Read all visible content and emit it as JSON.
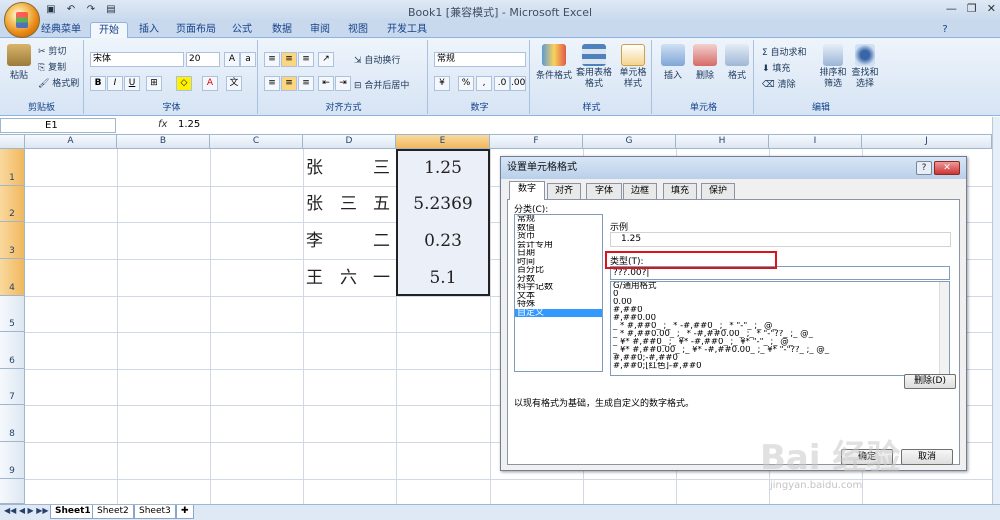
{
  "window": {
    "title": "Book1  [兼容模式] - Microsoft Excel"
  },
  "tabs": [
    "经典菜单",
    "开始",
    "插入",
    "页面布局",
    "公式",
    "数据",
    "审阅",
    "视图",
    "开发工具"
  ],
  "ribbon": {
    "clipboard": {
      "label": "剪贴板",
      "paste": "粘贴",
      "cut": "剪切",
      "copy": "复制",
      "painter": "格式刷"
    },
    "font": {
      "label": "字体",
      "name": "宋体",
      "size": "20"
    },
    "align": {
      "label": "对齐方式",
      "wrap": "自动换行",
      "merge": "合并后居中"
    },
    "number": {
      "label": "数字",
      "format": "常规"
    },
    "styles": {
      "label": "样式",
      "cond": "条件格式",
      "table": "套用表格格式",
      "cell": "单元格样式"
    },
    "cells": {
      "label": "单元格",
      "insert": "插入",
      "delete": "删除",
      "format": "格式"
    },
    "edit": {
      "label": "编辑",
      "autosum": "Σ 自动求和",
      "fill": "填充",
      "clear": "清除",
      "sort": "排序和筛选",
      "find": "查找和选择"
    }
  },
  "formula": {
    "namebox": "E1",
    "fx": "fx",
    "value": "1.25"
  },
  "columns": [
    "A",
    "B",
    "C",
    "D",
    "E",
    "F",
    "G",
    "H",
    "I",
    "J"
  ],
  "rows": [
    "1",
    "2",
    "3",
    "4",
    "5",
    "6",
    "7",
    "8",
    "9"
  ],
  "cells": {
    "names": [
      [
        "张",
        "",
        "三"
      ],
      [
        "张",
        "三",
        "五"
      ],
      [
        "李",
        "",
        "二"
      ],
      [
        "王",
        "六",
        "一"
      ]
    ],
    "values": [
      "1.25",
      "5.2369",
      "0.23",
      "5.1"
    ]
  },
  "sheets": [
    "Sheet1",
    "Sheet2",
    "Sheet3"
  ],
  "dialog": {
    "title": "设置单元格格式",
    "tabs": [
      "数字",
      "对齐",
      "字体",
      "边框",
      "填充",
      "保护"
    ],
    "category_label": "分类(C):",
    "categories": [
      "常规",
      "数值",
      "货币",
      "会计专用",
      "日期",
      "时间",
      "百分比",
      "分数",
      "科学记数",
      "文本",
      "特殊",
      "自定义"
    ],
    "sample_label": "示例",
    "sample_value": "1.25",
    "type_label": "类型(T):",
    "type_value": "???.00?|",
    "formats": [
      "G/通用格式",
      "0",
      "0.00",
      "#,##0",
      "#,##0.00",
      "_ * #,##0_ ;_ * -#,##0_ ;_ * \"-\"_ ;_ @_",
      "_ * #,##0.00_ ;_ * -#,##0.00_ ;_ * \"-\"??_ ;_ @_",
      "_ ¥* #,##0_ ;_ ¥* -#,##0_ ;_ ¥* \"-\"_ ;_ @_",
      "_ ¥* #,##0.00_ ;_ ¥* -#,##0.00_ ;_ ¥* \"-\"??_ ;_ @_",
      "#,##0;-#,##0",
      "#,##0;[红色]-#,##0"
    ],
    "delete_btn": "删除(D)",
    "hint": "以现有格式为基础，生成自定义的数字格式。",
    "ok": "确定",
    "cancel": "取消"
  },
  "watermark": {
    "brand": "Bai 经验",
    "url": "jingyan.baidu.com"
  }
}
